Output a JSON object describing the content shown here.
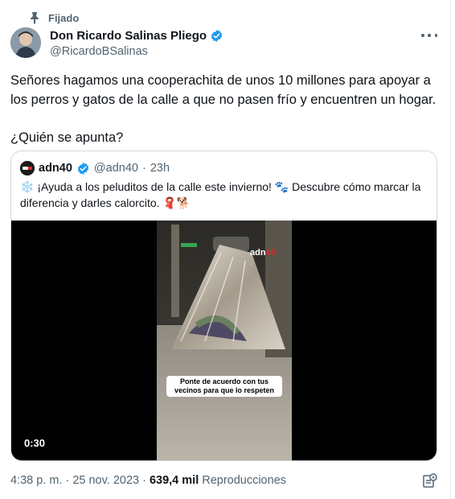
{
  "pinned_label": "Fijado",
  "author": {
    "name": "Don Ricardo Salinas Pliego",
    "handle": "@RicardoBSalinas"
  },
  "tweet": {
    "paragraph1": "Señores hagamos una cooperachita de unos 10 millones para apoyar a los perros y gatos de la calle a que no pasen frío y encuentren un hogar.",
    "paragraph2": "¿Quién se apunta?"
  },
  "quote": {
    "name": "adn40",
    "handle": "@adn40",
    "separator": "·",
    "time": "23h",
    "text": "❄️ ¡Ayuda a los pelud­itos de la calle este invierno! 🐾 Descubre cómo marcar la diferencia y darles calorcito. 🧣🐕",
    "video": {
      "duration": "0:30",
      "caption": "Ponte de acuerdo con tus vecinos para que lo respeten",
      "watermark_prefix": "adn",
      "watermark_suffix": "40"
    }
  },
  "footer": {
    "time": "4:38 p. m.",
    "separator1": "·",
    "date": "25 nov. 2023",
    "separator2": "·",
    "views_count": "639,4 mil",
    "views_label": "Reproducciones"
  },
  "colors": {
    "text": "#0f1419",
    "secondary": "#536471",
    "verified": "#1d9bf0",
    "border": "#cfd9de"
  },
  "icons": [
    "pin-icon",
    "verified-badge-icon",
    "more-options-icon",
    "video-play-timer",
    "post-analytics-icon"
  ]
}
